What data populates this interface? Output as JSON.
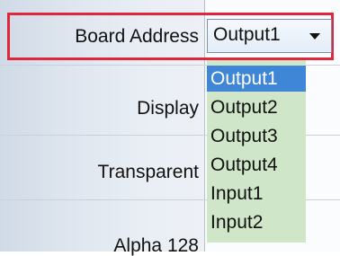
{
  "properties": {
    "rows": [
      {
        "label": "Board Address"
      },
      {
        "label": "Display"
      },
      {
        "label": "Transparent"
      },
      {
        "label": "Alpha 128"
      }
    ]
  },
  "combo": {
    "value": "Output1",
    "arrow_icon": "triangle-down-icon"
  },
  "dropdown": {
    "selected_index": 0,
    "options": [
      "Output1",
      "Output2",
      "Output3",
      "Output4",
      "Input1",
      "Input2"
    ]
  },
  "highlight_color": "#e0263a",
  "selection_color": "#3f86d6"
}
